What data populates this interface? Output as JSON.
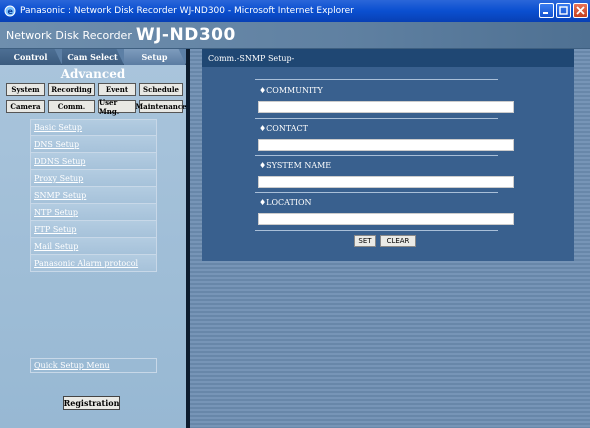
{
  "window": {
    "title": "Panasonic : Network Disk Recorder WJ-ND300 - Microsoft Internet Explorer"
  },
  "header": {
    "prefix": "Network Disk Recorder",
    "model": "WJ-ND300"
  },
  "tabs": [
    {
      "label": "Control"
    },
    {
      "label": "Cam Select"
    },
    {
      "label": "Setup"
    }
  ],
  "advanced": {
    "title": "Advanced",
    "row1": [
      "System",
      "Recording",
      "Event",
      "Schedule"
    ],
    "row2": [
      "Camera",
      "Comm.",
      "User Mng.",
      "Maintenance"
    ]
  },
  "submenu": [
    "Basic Setup",
    "DNS Setup",
    "DDNS Setup",
    "Proxy Setup",
    "SNMP Setup",
    "NTP Setup",
    "FTP Setup",
    "Mail Setup",
    "Panasonic Alarm protocol"
  ],
  "quick_setup": "Quick Setup Menu",
  "registration": "Registration",
  "panel": {
    "header": "Comm.-SNMP Setup-",
    "fields": [
      {
        "label": "♦COMMUNITY",
        "value": ""
      },
      {
        "label": "♦CONTACT",
        "value": ""
      },
      {
        "label": "♦SYSTEM NAME",
        "value": ""
      },
      {
        "label": "♦LOCATION",
        "value": ""
      }
    ],
    "set_label": "SET",
    "clear_label": "CLEAR"
  },
  "colors": {
    "title_bar": "#0a4fd0",
    "panel": "#39608e",
    "panel_header": "#1f4773",
    "left_panel": "#a6c2da"
  }
}
